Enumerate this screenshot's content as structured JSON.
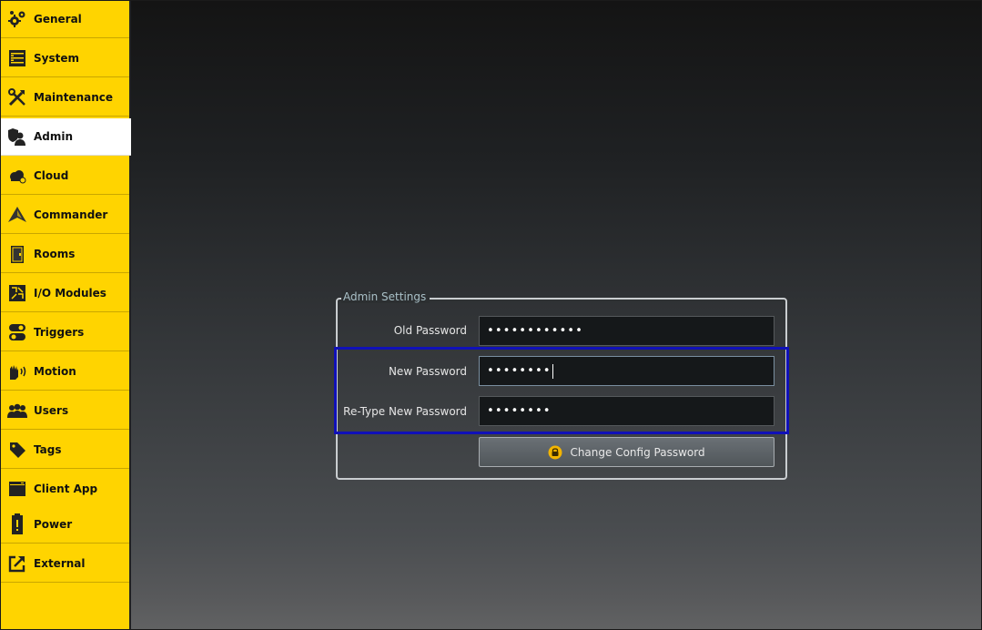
{
  "sidebar": {
    "items": [
      {
        "label": "General",
        "icon": "gears-icon",
        "active": false
      },
      {
        "label": "System",
        "icon": "server-icon",
        "active": false
      },
      {
        "label": "Maintenance",
        "icon": "tools-icon",
        "active": false
      },
      {
        "label": "Admin",
        "icon": "admin-shield-user-icon",
        "active": true
      },
      {
        "label": "Cloud",
        "icon": "cloud-icon",
        "active": false
      },
      {
        "label": "Commander",
        "icon": "commander-logo-icon",
        "active": false
      },
      {
        "label": "Rooms",
        "icon": "door-icon",
        "active": false
      },
      {
        "label": "I/O Modules",
        "icon": "io-module-icon",
        "active": false
      },
      {
        "label": "Triggers",
        "icon": "toggle-switch-icon",
        "active": false
      },
      {
        "label": "Motion",
        "icon": "hand-wave-icon",
        "active": false
      },
      {
        "label": "Users",
        "icon": "users-group-icon",
        "active": false
      },
      {
        "label": "Tags",
        "icon": "tag-icon",
        "active": false
      },
      {
        "label": "Client App",
        "icon": "app-window-icon",
        "active": false
      },
      {
        "label": "Power",
        "icon": "battery-warning-icon",
        "active": false
      },
      {
        "label": "External",
        "icon": "external-link-icon",
        "active": false
      }
    ],
    "accent": "#ffd400"
  },
  "admin_settings": {
    "title": "Admin Settings",
    "old_password_label": "Old Password",
    "old_password_value": "••••••••••••",
    "new_password_label": "New Password",
    "new_password_value": "••••••••",
    "retype_password_label": "Re-Type New Password",
    "retype_password_value": "••••••••",
    "change_button_label": "Change Config Password",
    "highlight_color": "#1010b8"
  }
}
